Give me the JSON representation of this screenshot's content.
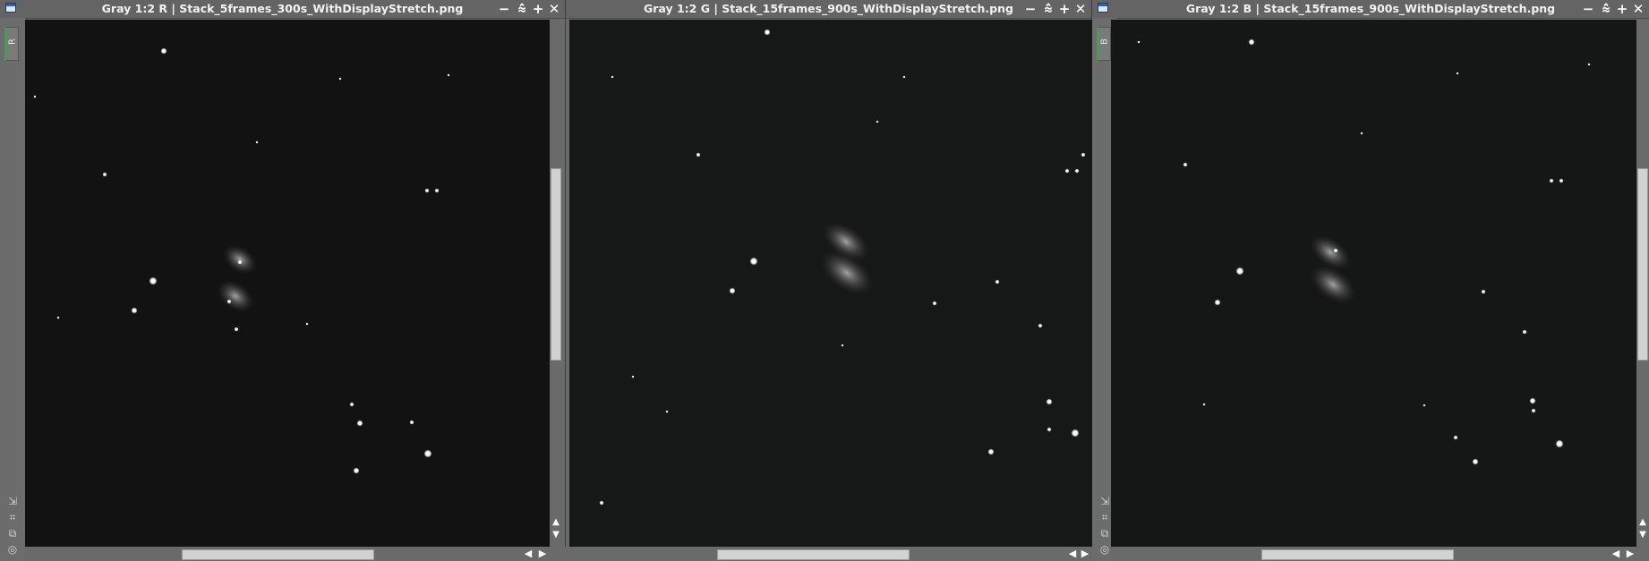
{
  "windows": [
    {
      "title": "Gray 1:2 R | Stack_5frames_300s_WithDisplayStretch.png",
      "channel": "R",
      "background": "#121212",
      "stars": [
        [
          183,
          57,
          3
        ],
        [
          117,
          195,
          2
        ],
        [
          171,
          314,
          4
        ],
        [
          150,
          347,
          3
        ],
        [
          477,
          213,
          2
        ],
        [
          488,
          213,
          2
        ],
        [
          256,
          337,
          2
        ],
        [
          268,
          293,
          2
        ],
        [
          264,
          368,
          2
        ],
        [
          393,
          452,
          2
        ],
        [
          402,
          473,
          3
        ],
        [
          460,
          472,
          2
        ],
        [
          478,
          507,
          4
        ],
        [
          398,
          526,
          3
        ],
        [
          39,
          108,
          1
        ],
        [
          65,
          355,
          1
        ],
        [
          287,
          159,
          1
        ],
        [
          343,
          362,
          1
        ],
        [
          501,
          84,
          1
        ],
        [
          380,
          88,
          1
        ]
      ],
      "galaxy": [
        [
          268,
          290,
          42,
          28
        ],
        [
          263,
          331,
          46,
          30
        ]
      ]
    },
    {
      "title": "Gray 1:2 G | Stack_15frames_900s_WithDisplayStretch.png",
      "channel": "",
      "background": "#161717",
      "stars": [
        [
          857,
          36,
          3
        ],
        [
          780,
          173,
          2
        ],
        [
          842,
          292,
          4
        ],
        [
          818,
          325,
          3
        ],
        [
          1192,
          191,
          2
        ],
        [
          1203,
          191,
          2
        ],
        [
          1114,
          315,
          2
        ],
        [
          1044,
          339,
          2
        ],
        [
          1162,
          364,
          2
        ],
        [
          1172,
          449,
          3
        ],
        [
          1172,
          480,
          2
        ],
        [
          1201,
          484,
          4
        ],
        [
          1107,
          505,
          3
        ],
        [
          672,
          562,
          2
        ],
        [
          684,
          86,
          1
        ],
        [
          707,
          421,
          1
        ],
        [
          745,
          460,
          1
        ],
        [
          980,
          136,
          1
        ],
        [
          1010,
          86,
          1
        ],
        [
          941,
          386,
          1
        ],
        [
          1210,
          173,
          2
        ]
      ],
      "galaxy": [
        [
          945,
          270,
          60,
          34
        ],
        [
          946,
          305,
          68,
          38
        ]
      ]
    },
    {
      "title": "Gray 1:2 B | Stack_15frames_900s_WithDisplayStretch.png",
      "channel": "B",
      "background": "#151616",
      "stars": [
        [
          1398,
          47,
          3
        ],
        [
          1324,
          184,
          2
        ],
        [
          1385,
          303,
          4
        ],
        [
          1360,
          338,
          3
        ],
        [
          1733,
          202,
          2
        ],
        [
          1744,
          202,
          2
        ],
        [
          1492,
          280,
          2
        ],
        [
          1657,
          326,
          2
        ],
        [
          1703,
          371,
          2
        ],
        [
          1712,
          448,
          3
        ],
        [
          1713,
          459,
          2
        ],
        [
          1742,
          496,
          4
        ],
        [
          1648,
          516,
          3
        ],
        [
          1626,
          489,
          2
        ],
        [
          1591,
          453,
          1
        ],
        [
          1521,
          149,
          1
        ],
        [
          1628,
          82,
          1
        ],
        [
          1775,
          72,
          1
        ],
        [
          1345,
          452,
          1
        ],
        [
          1272,
          47,
          1
        ]
      ],
      "galaxy": [
        [
          1486,
          282,
          52,
          30
        ],
        [
          1489,
          318,
          58,
          34
        ]
      ]
    }
  ]
}
